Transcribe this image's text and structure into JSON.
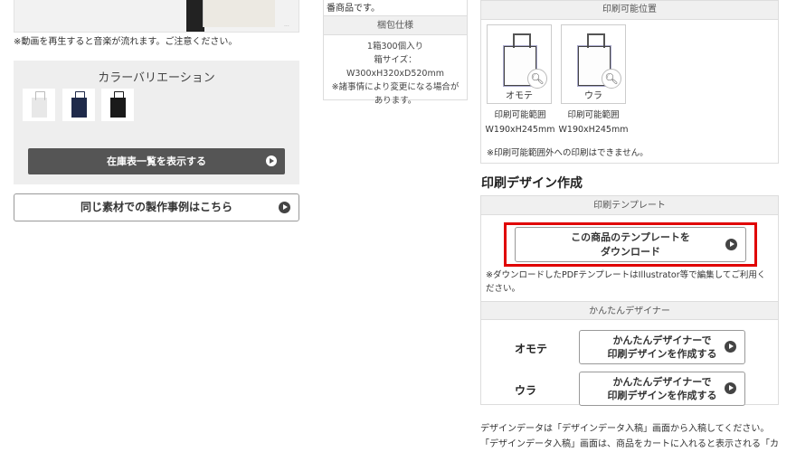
{
  "left": {
    "video_note": "※動画を再生すると音楽が流れます。ご注意ください。",
    "color_variation": {
      "title": "カラーバリエーション",
      "swatches": [
        {
          "name": "white",
          "color": "#e8e8e8",
          "handle": "#bbbbbb"
        },
        {
          "name": "navy",
          "color": "#1f2a4a",
          "handle": "#1f2a4a"
        },
        {
          "name": "black",
          "color": "#1a1a1a",
          "handle": "#1a1a1a"
        }
      ],
      "inventory_button": "在庫表一覧を表示する"
    },
    "same_material_button": "同じ素材での製作事例はこちら"
  },
  "middle": {
    "top_text": "番商品です。",
    "packing": {
      "heading": "梱包仕様",
      "line1": "1箱300個入り",
      "line2": "箱サイズ：W300xH320xD520mm",
      "line3": "※諸事情により変更になる場合があります。"
    }
  },
  "right": {
    "print_position": {
      "heading": "印刷可能位置",
      "items": [
        {
          "label": "オモテ",
          "range_label": "印刷可能範囲",
          "size": "W190xH245mm"
        },
        {
          "label": "ウラ",
          "range_label": "印刷可能範囲",
          "size": "W190xH245mm"
        }
      ],
      "note": "※印刷可能範囲外への印刷はできません。"
    },
    "design": {
      "title": "印刷デザイン作成",
      "template_heading": "印刷テンプレート",
      "download_line1": "この商品のテンプレートを",
      "download_line2": "ダウンロード",
      "download_note": "※ダウンロードしたPDFテンプレートはIllustrator等で編集してご利用ください。",
      "designer_heading": "かんたんデザイナー",
      "rows": [
        {
          "side": "オモテ",
          "line1": "かんたんデザイナーで",
          "line2": "印刷デザインを作成する"
        },
        {
          "side": "ウラ",
          "line1": "かんたんデザイナーで",
          "line2": "印刷デザインを作成する"
        }
      ]
    },
    "bottom_note": "デザインデータは「デザインデータ入稿」画面から入稿してください。「デザインデータ入稿」画面は、商品をカートに入れると表示される「カートの確認」画"
  }
}
